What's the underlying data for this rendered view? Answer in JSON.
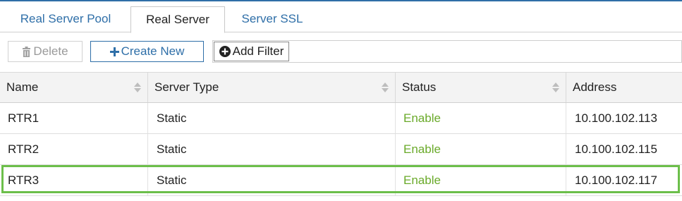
{
  "tabs": [
    {
      "label": "Real Server Pool",
      "active": false
    },
    {
      "label": "Real Server",
      "active": true
    },
    {
      "label": "Server SSL",
      "active": false
    }
  ],
  "toolbar": {
    "delete_label": "Delete",
    "delete_icon": "trash-icon",
    "create_label": "Create New",
    "create_icon": "plus-icon",
    "filter_label": "Add Filter",
    "filter_icon": "plus-circle-icon"
  },
  "table": {
    "columns": [
      "Name",
      "Server Type",
      "Status",
      "Address"
    ],
    "rows": [
      {
        "name": "RTR1",
        "type": "Static",
        "status": "Enable",
        "address": "10.100.102.113"
      },
      {
        "name": "RTR2",
        "type": "Static",
        "status": "Enable",
        "address": "10.100.102.115"
      },
      {
        "name": "RTR3",
        "type": "Static",
        "status": "Enable",
        "address": "10.100.102.117",
        "highlighted": true
      }
    ]
  },
  "colors": {
    "accent": "#2f6fa8",
    "status_enable": "#6aaa2a",
    "highlight": "#6cbf4a",
    "disabled_text": "#9a9a9a"
  }
}
